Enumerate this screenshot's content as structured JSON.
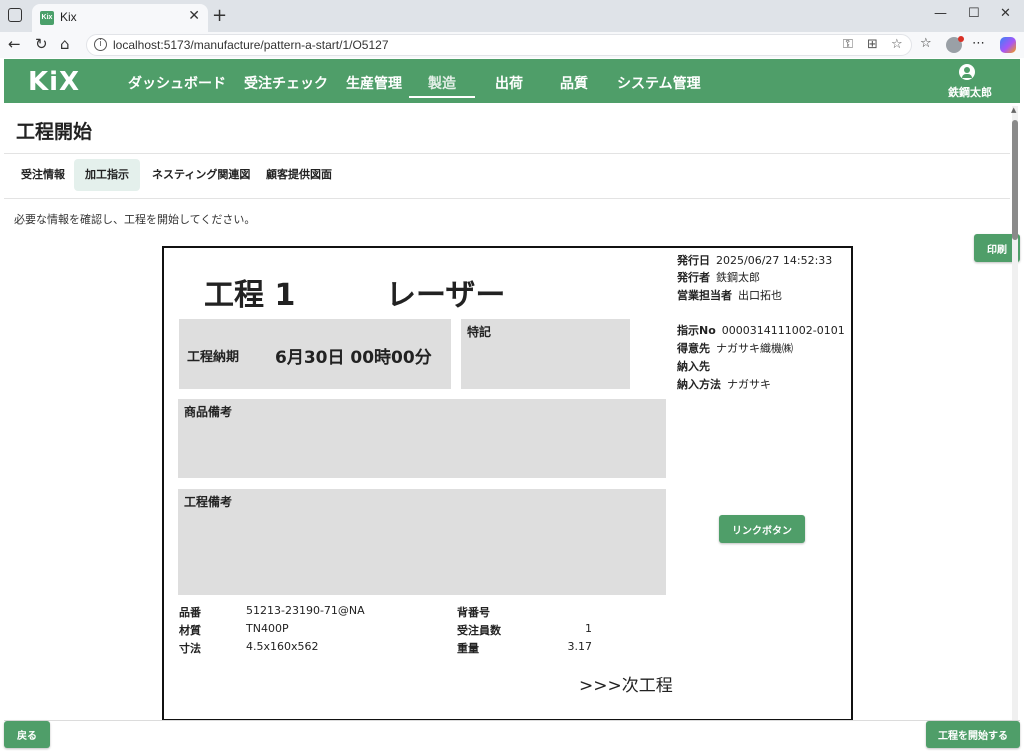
{
  "browser": {
    "tab_title": "Kix",
    "tab_favicon": "Kix",
    "tab_close": "✕",
    "new_tab": "+",
    "url": "localhost:5173/manufacture/pattern-a-start/1/O5127",
    "window_controls": [
      "—",
      "☐",
      "✕"
    ]
  },
  "app": {
    "logo": "KiX",
    "nav": [
      "ダッシュボード",
      "受注チェック",
      "生産管理",
      "製造",
      "出荷",
      "品質",
      "システム管理"
    ],
    "active_nav": "製造",
    "user_name": "鉄鋼太郎",
    "accent_color": "#4f9e69"
  },
  "page": {
    "title": "工程開始",
    "tabs": [
      "受注情報",
      "加工指示",
      "ネスティング関連図",
      "顧客提供図面"
    ],
    "active_tab": "加工指示",
    "instruction": "必要な情報を確認し、工程を開始してください。",
    "print_button": "印刷",
    "back_button": "戻る",
    "start_button": "工程を開始する"
  },
  "document": {
    "process_no": "工程 1",
    "process_name": "レーザー",
    "deadline_label": "工程納期",
    "deadline_value": "6月30日 00時00分",
    "special_label": "特記",
    "product_note_label": "商品備考",
    "process_note_label": "工程備考",
    "meta_top": [
      {
        "label": "発行日",
        "value": "2025/06/27 14:52:33"
      },
      {
        "label": "発行者",
        "value": "鉄鋼太郎"
      },
      {
        "label": "営業担当者",
        "value": "出口拓也"
      }
    ],
    "meta_mid": [
      {
        "label": "指示No",
        "value": "0000314111002-0101"
      },
      {
        "label": "得意先",
        "value": "ナガサキ織機㈱"
      },
      {
        "label": "納入先",
        "value": ""
      },
      {
        "label": "納入方法",
        "value": "ナガサキ"
      }
    ],
    "link_button": "リンクボタン",
    "specs_left": [
      {
        "label": "品番",
        "value": "51213-23190-71@NA"
      },
      {
        "label": "材質",
        "value": "TN400P"
      },
      {
        "label": "寸法",
        "value": "4.5x160x562"
      }
    ],
    "specs_right": [
      {
        "label": "背番号",
        "value": ""
      },
      {
        "label": "受注員数",
        "value": "1"
      },
      {
        "label": "重量",
        "value": "3.17"
      }
    ],
    "next_step": ">>>次工程"
  }
}
